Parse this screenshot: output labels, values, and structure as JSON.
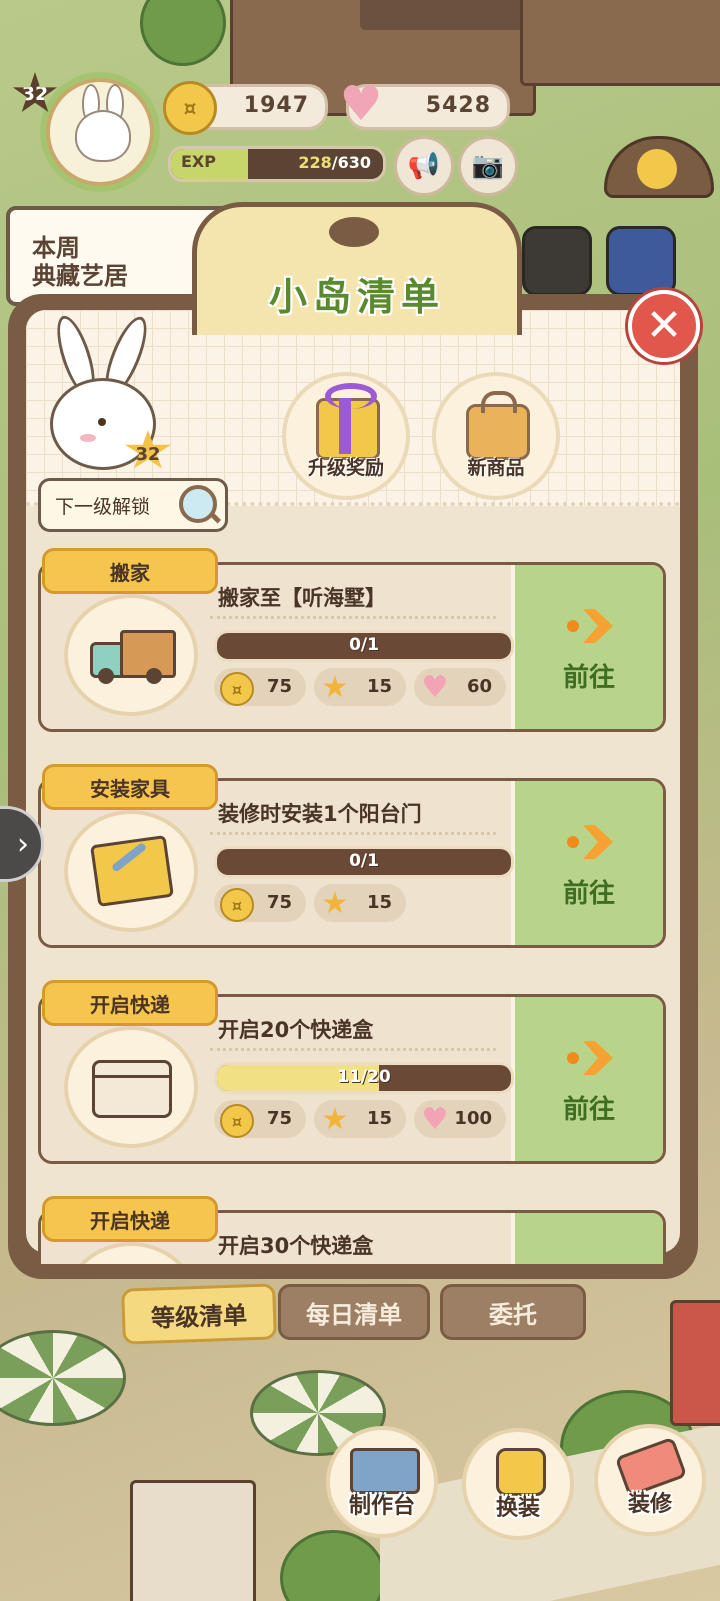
{
  "hud": {
    "level": "32",
    "coins": "1947",
    "hearts": "5428",
    "exp_label": "EXP",
    "exp_current": "228",
    "exp_total": "/630",
    "exp_fraction": 0.362,
    "weekly_banner_line1": "本周",
    "weekly_banner_line2": "典藏艺居"
  },
  "panel": {
    "title": "小岛清单",
    "close_label": "✕",
    "bunny_level": "32",
    "unlock_label": "下一级解锁",
    "rewards": [
      {
        "label": "升级奖励",
        "icon": "gift-icon"
      },
      {
        "label": "新商品",
        "icon": "bag-icon"
      }
    ],
    "go_label": "前往"
  },
  "tasks": [
    {
      "category": "搬家",
      "title": "搬家至【听海墅】",
      "progress_text": "0/1",
      "progress": 0.0,
      "icon": "moving-truck-icon",
      "rewards": [
        {
          "type": "coin",
          "value": "75"
        },
        {
          "type": "star",
          "value": "15"
        },
        {
          "type": "heart",
          "value": "60"
        }
      ]
    },
    {
      "category": "安装家具",
      "title": "装修时安装1个阳台门",
      "progress_text": "0/1",
      "progress": 0.0,
      "icon": "toolbox-icon",
      "rewards": [
        {
          "type": "coin",
          "value": "75"
        },
        {
          "type": "star",
          "value": "15"
        }
      ]
    },
    {
      "category": "开启快递",
      "title": "开启20个快递盒",
      "progress_text": "11/20",
      "progress": 0.55,
      "icon": "parcel-box-icon",
      "rewards": [
        {
          "type": "coin",
          "value": "75"
        },
        {
          "type": "star",
          "value": "15"
        },
        {
          "type": "heart",
          "value": "100"
        }
      ]
    },
    {
      "category": "开启快递",
      "title": "开启30个快递盒",
      "icon": "parcel-box-icon"
    }
  ],
  "tabs": [
    {
      "label": "等级清单",
      "active": true
    },
    {
      "label": "每日清单",
      "active": false
    },
    {
      "label": "委托",
      "active": false
    }
  ],
  "nav": [
    {
      "label": "制作台",
      "icon": "workbench-icon"
    },
    {
      "label": "换装",
      "icon": "outfit-icon"
    },
    {
      "label": "装修",
      "icon": "decorate-icon"
    }
  ],
  "colors": {
    "panel_border": "#7a5b44",
    "go_green": "#b8d48a",
    "tab_gold": "#f5c54e",
    "title_green": "#5a8a30",
    "close_red": "#e2574c"
  }
}
